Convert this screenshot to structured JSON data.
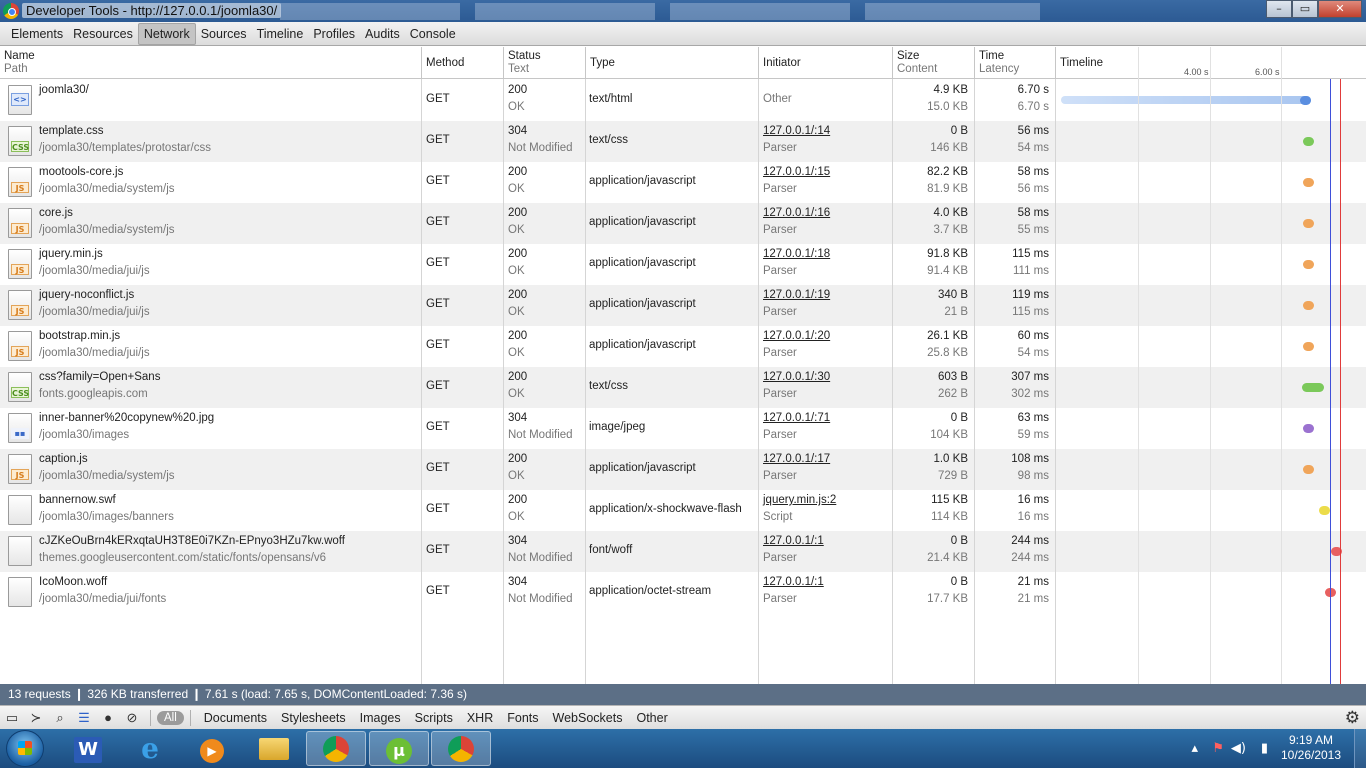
{
  "window": {
    "title": "Developer Tools - http://127.0.0.1/joomla30/"
  },
  "panel_tabs": [
    "Elements",
    "Resources",
    "Network",
    "Sources",
    "Timeline",
    "Profiles",
    "Audits",
    "Console"
  ],
  "active_panel": "Network",
  "columns": {
    "name": "Name",
    "path": "Path",
    "method": "Method",
    "status": "Status",
    "text": "Text",
    "type": "Type",
    "initiator": "Initiator",
    "size": "Size",
    "content": "Content",
    "time": "Time",
    "latency": "Latency",
    "timeline": "Timeline"
  },
  "timeline_ticks": [
    "4.00 s",
    "6.00 s"
  ],
  "requests": [
    {
      "icon": "html-icon",
      "name": "joomla30/",
      "path": "",
      "method": "GET",
      "status": "200",
      "status_text": "OK",
      "type": "text/html",
      "initiator": "Other",
      "initiator_link": "",
      "initiator_type": "",
      "size": "4.9 KB",
      "content": "15.0 KB",
      "time": "6.70 s",
      "latency": "6.70 s",
      "color": "#5a8ee0"
    },
    {
      "icon": "css-icon",
      "name": "template.css",
      "path": "/joomla30/templates/protostar/css",
      "method": "GET",
      "status": "304",
      "status_text": "Not Modified",
      "type": "text/css",
      "initiator": "",
      "initiator_link": "127.0.0.1/:14",
      "initiator_type": "Parser",
      "size": "0 B",
      "content": "146 KB",
      "time": "56 ms",
      "latency": "54 ms",
      "color": "#7bc95a"
    },
    {
      "icon": "js-icon",
      "name": "mootools-core.js",
      "path": "/joomla30/media/system/js",
      "method": "GET",
      "status": "200",
      "status_text": "OK",
      "type": "application/javascript",
      "initiator": "",
      "initiator_link": "127.0.0.1/:15",
      "initiator_type": "Parser",
      "size": "82.2 KB",
      "content": "81.9 KB",
      "time": "58 ms",
      "latency": "56 ms",
      "color": "#f0a55a"
    },
    {
      "icon": "js-icon",
      "name": "core.js",
      "path": "/joomla30/media/system/js",
      "method": "GET",
      "status": "200",
      "status_text": "OK",
      "type": "application/javascript",
      "initiator": "",
      "initiator_link": "127.0.0.1/:16",
      "initiator_type": "Parser",
      "size": "4.0 KB",
      "content": "3.7 KB",
      "time": "58 ms",
      "latency": "55 ms",
      "color": "#f0a55a"
    },
    {
      "icon": "js-icon",
      "name": "jquery.min.js",
      "path": "/joomla30/media/jui/js",
      "method": "GET",
      "status": "200",
      "status_text": "OK",
      "type": "application/javascript",
      "initiator": "",
      "initiator_link": "127.0.0.1/:18",
      "initiator_type": "Parser",
      "size": "91.8 KB",
      "content": "91.4 KB",
      "time": "115 ms",
      "latency": "111 ms",
      "color": "#f0a55a"
    },
    {
      "icon": "js-icon",
      "name": "jquery-noconflict.js",
      "path": "/joomla30/media/jui/js",
      "method": "GET",
      "status": "200",
      "status_text": "OK",
      "type": "application/javascript",
      "initiator": "",
      "initiator_link": "127.0.0.1/:19",
      "initiator_type": "Parser",
      "size": "340 B",
      "content": "21 B",
      "time": "119 ms",
      "latency": "115 ms",
      "color": "#f0a55a"
    },
    {
      "icon": "js-icon",
      "name": "bootstrap.min.js",
      "path": "/joomla30/media/jui/js",
      "method": "GET",
      "status": "200",
      "status_text": "OK",
      "type": "application/javascript",
      "initiator": "",
      "initiator_link": "127.0.0.1/:20",
      "initiator_type": "Parser",
      "size": "26.1 KB",
      "content": "25.8 KB",
      "time": "60 ms",
      "latency": "54 ms",
      "color": "#f0a55a"
    },
    {
      "icon": "css-icon",
      "name": "css?family=Open+Sans",
      "path": "fonts.googleapis.com",
      "method": "GET",
      "status": "200",
      "status_text": "OK",
      "type": "text/css",
      "initiator": "",
      "initiator_link": "127.0.0.1/:30",
      "initiator_type": "Parser",
      "size": "603 B",
      "content": "262 B",
      "time": "307 ms",
      "latency": "302 ms",
      "color": "#7bc95a"
    },
    {
      "icon": "image-icon",
      "name": "inner-banner%20copynew%20.jpg",
      "path": "/joomla30/images",
      "method": "GET",
      "status": "304",
      "status_text": "Not Modified",
      "type": "image/jpeg",
      "initiator": "",
      "initiator_link": "127.0.0.1/:71",
      "initiator_type": "Parser",
      "size": "0 B",
      "content": "104 KB",
      "time": "63 ms",
      "latency": "59 ms",
      "color": "#9b72d0"
    },
    {
      "icon": "js-icon",
      "name": "caption.js",
      "path": "/joomla30/media/system/js",
      "method": "GET",
      "status": "200",
      "status_text": "OK",
      "type": "application/javascript",
      "initiator": "",
      "initiator_link": "127.0.0.1/:17",
      "initiator_type": "Parser",
      "size": "1.0 KB",
      "content": "729 B",
      "time": "108 ms",
      "latency": "98 ms",
      "color": "#f0a55a"
    },
    {
      "icon": "file-icon",
      "name": "bannernow.swf",
      "path": "/joomla30/images/banners",
      "method": "GET",
      "status": "200",
      "status_text": "OK",
      "type": "application/x-shockwave-flash",
      "initiator": "",
      "initiator_link": "jquery.min.js:2",
      "initiator_type": "Script",
      "size": "115 KB",
      "content": "114 KB",
      "time": "16 ms",
      "latency": "16 ms",
      "color": "#ecdc4a"
    },
    {
      "icon": "file-icon",
      "name": "cJZKeOuBrn4kERxqtaUH3T8E0i7KZn-EPnyo3HZu7kw.woff",
      "path": "themes.googleusercontent.com/static/fonts/opensans/v6",
      "method": "GET",
      "status": "304",
      "status_text": "Not Modified",
      "type": "font/woff",
      "initiator": "",
      "initiator_link": "127.0.0.1/:1",
      "initiator_type": "Parser",
      "size": "0 B",
      "content": "21.4 KB",
      "time": "244 ms",
      "latency": "244 ms",
      "color": "#e86060"
    },
    {
      "icon": "file-icon",
      "name": "IcoMoon.woff",
      "path": "/joomla30/media/jui/fonts",
      "method": "GET",
      "status": "304",
      "status_text": "Not Modified",
      "type": "application/octet-stream",
      "initiator": "",
      "initiator_link": "127.0.0.1/:1",
      "initiator_type": "Parser",
      "size": "0 B",
      "content": "17.7 KB",
      "time": "21 ms",
      "latency": "21 ms",
      "color": "#e86060"
    }
  ],
  "status_bar": {
    "text": "13 requests  ❙  326 KB transferred  ❙  7.61 s (load: 7.65 s, DOMContentLoaded: 7.36 s)"
  },
  "filters": [
    "All",
    "Documents",
    "Stylesheets",
    "Images",
    "Scripts",
    "XHR",
    "Fonts",
    "WebSockets",
    "Other"
  ],
  "active_filter": "All",
  "clock": {
    "time": "9:19 AM",
    "date": "10/26/2013"
  },
  "taskbar_apps": [
    "Microsoft Word",
    "Internet Explorer",
    "Windows Media Player",
    "Windows Explorer",
    "Google Chrome",
    "uTorrent",
    "Google Chrome"
  ]
}
